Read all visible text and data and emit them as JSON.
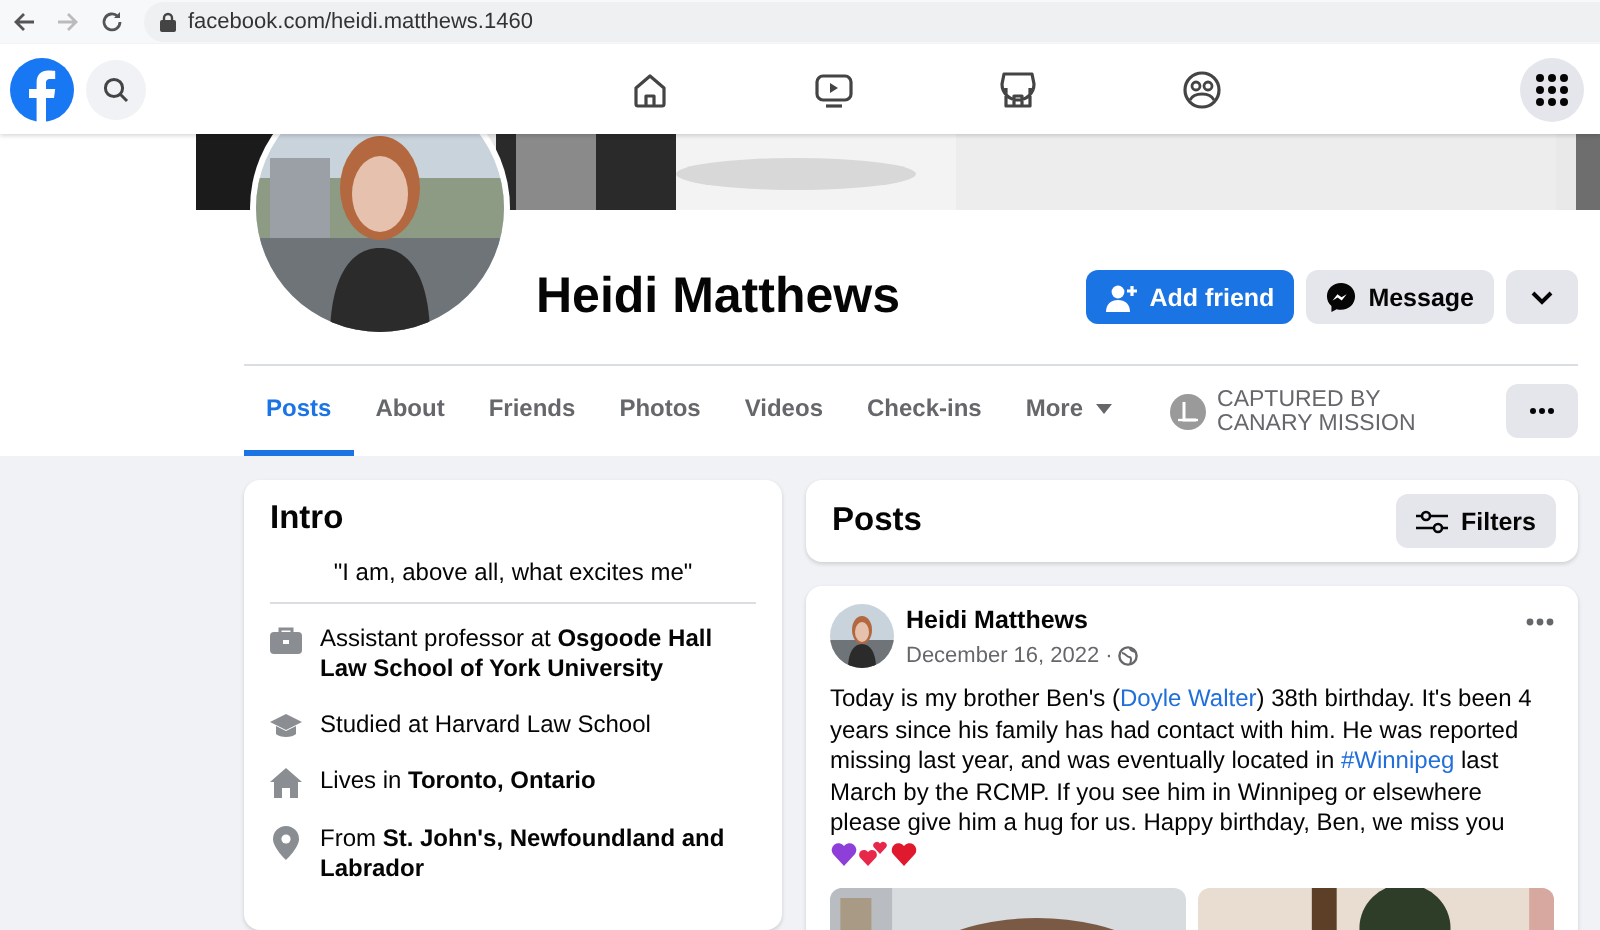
{
  "browser": {
    "url": "facebook.com/heidi.matthews.1460"
  },
  "profile": {
    "name": "Heidi Matthews",
    "actions": [
      {
        "kind": "primary",
        "label": "Add friend"
      },
      {
        "kind": "secondary",
        "label": "Message"
      },
      {
        "kind": "dropdown"
      }
    ],
    "tabs": [
      {
        "label": "Posts",
        "selected": true,
        "kind": "tab"
      },
      {
        "label": "About",
        "selected": false,
        "kind": "tab"
      },
      {
        "label": "Friends",
        "selected": false,
        "kind": "tab"
      },
      {
        "label": "Photos",
        "selected": false,
        "kind": "tab"
      },
      {
        "label": "Videos",
        "selected": false,
        "kind": "tab"
      },
      {
        "label": "Check-ins",
        "selected": false,
        "kind": "tab"
      },
      {
        "label": "More",
        "selected": false,
        "kind": "menu"
      }
    ],
    "badge": "CAPTURED BY CANARY MISSION"
  },
  "intro": {
    "title": "Intro",
    "bio": "\"I am, above all, what excites me\"",
    "items": [
      {
        "kind": "work",
        "text": "Assistant professor at **Osgoode Hall Law School of York University**"
      },
      {
        "kind": "education",
        "text": "Studied at Harvard Law School"
      },
      {
        "kind": "home",
        "text": "Lives in **Toronto, Ontario**"
      },
      {
        "kind": "origin",
        "text": "From **St. John's, Newfoundland and Labrador**"
      }
    ]
  },
  "posts": {
    "title": "Posts",
    "filter_button": "Filters",
    "post": {
      "author": "Heidi Matthews",
      "date": "December 16, 2022 ·",
      "segments": [
        {
          "kind": "plain",
          "text": "Today is my brother Ben's ("
        },
        {
          "kind": "link",
          "text": "Doyle Walter"
        },
        {
          "kind": "plain",
          "text": ") 38th birthday. It's been 4 years since his family has had contact with him. He was reported missing last year, and was eventually located in "
        },
        {
          "kind": "link",
          "text": "#Winnipeg"
        },
        {
          "kind": "plain",
          "text": " last March by the RCMP. If you see him in Winnipeg or elsewhere please give him a hug for us. Happy birthday, Ben, we miss you "
        }
      ]
    }
  }
}
